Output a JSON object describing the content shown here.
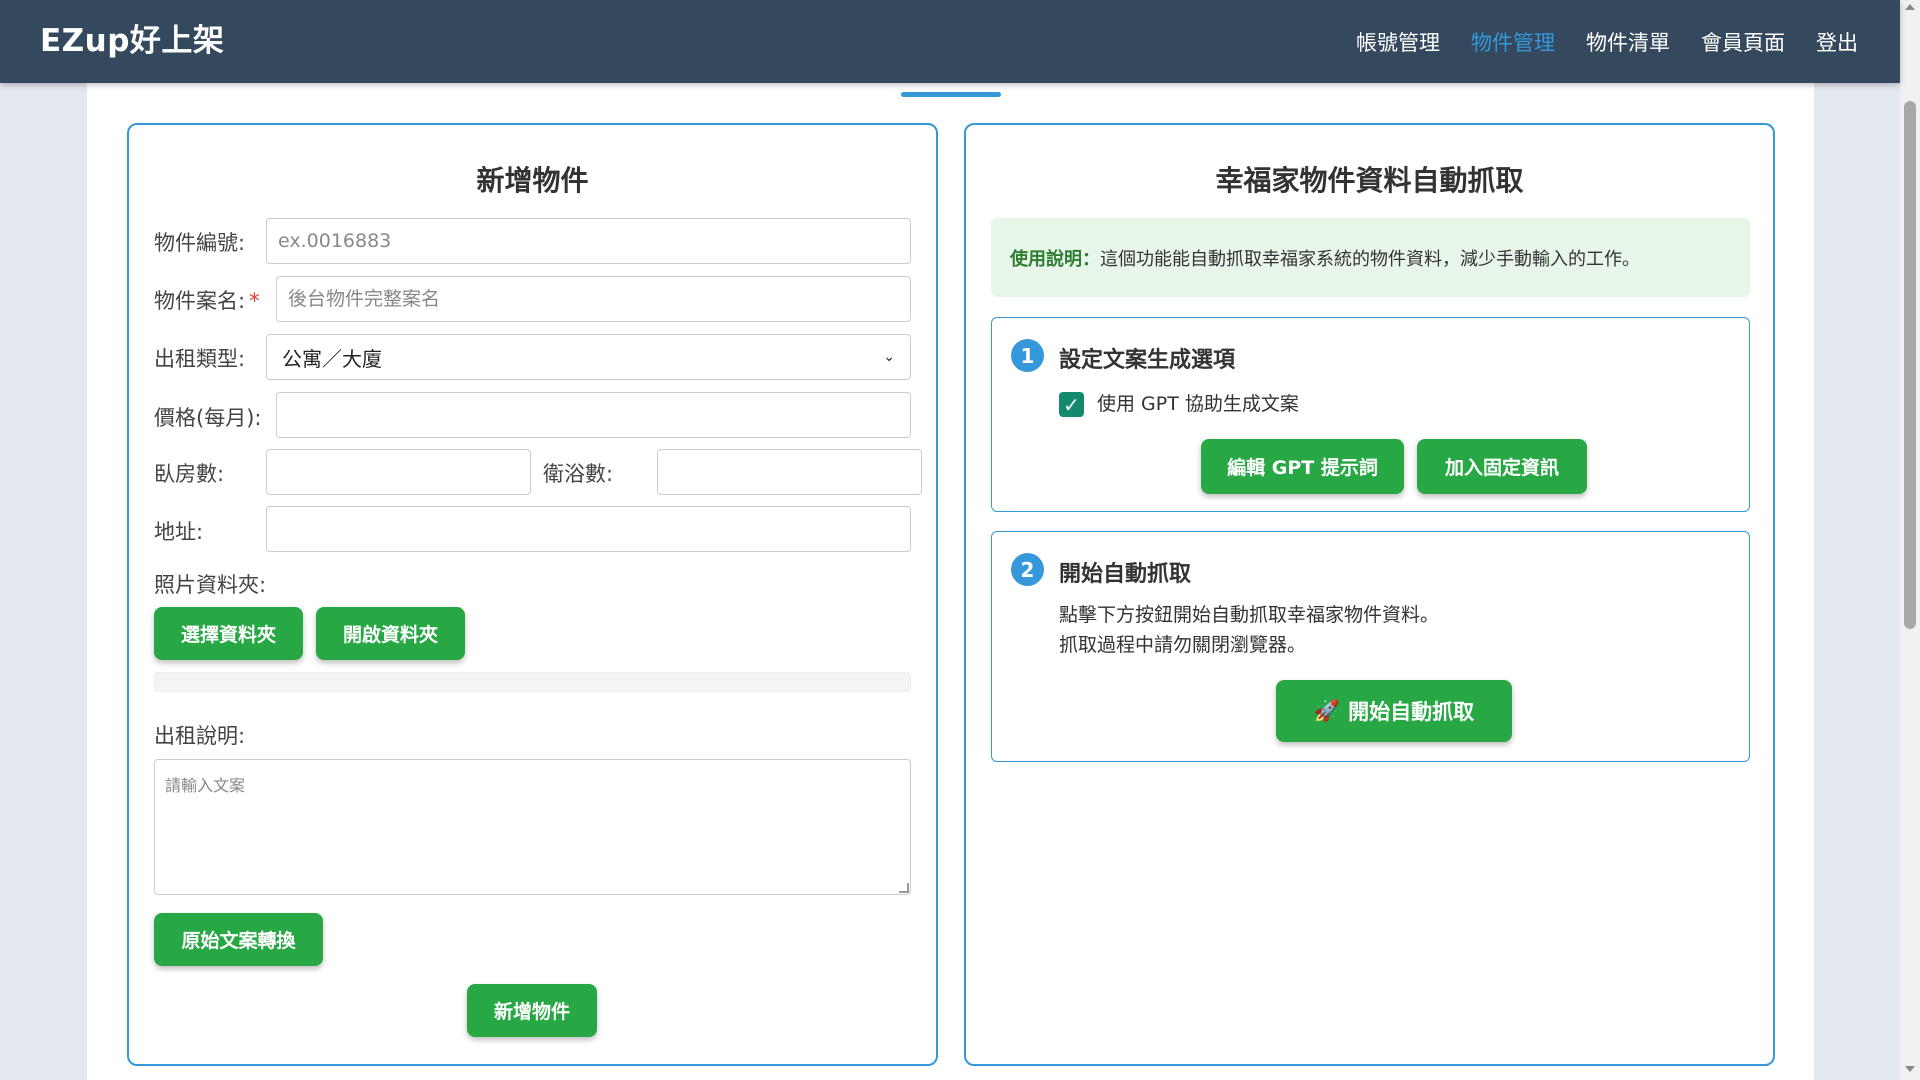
{
  "nav": {
    "brand": "EZup好上架",
    "links": [
      "帳號管理",
      "物件管理",
      "物件清單",
      "會員頁面",
      "登出"
    ],
    "active_index": 1
  },
  "left": {
    "title": "新增物件",
    "labels": {
      "id": "物件編號:",
      "name": "物件案名:",
      "required_mark": "*",
      "type": "出租類型:",
      "price": "價格(每月):",
      "bedrooms": "臥房數:",
      "bathrooms": "衛浴數:",
      "address": "地址:",
      "photos": "照片資料夾:",
      "description": "出租說明:"
    },
    "placeholders": {
      "id": "ex.0016883",
      "name": "後台物件完整案名",
      "description": "請輸入文案"
    },
    "type_value": "公寓／大廈",
    "buttons": {
      "select_folder": "選擇資料夾",
      "open_folder": "開啟資料夾",
      "convert": "原始文案轉換",
      "add": "新增物件"
    }
  },
  "right": {
    "title": "幸福家物件資料自動抓取",
    "info_label": "使用說明：",
    "info_text": "這個功能能自動抓取幸福家系統的物件資料，減少手動輸入的工作。",
    "step1": {
      "number": "1",
      "title": "設定文案生成選項",
      "checkbox_label": "使用 GPT 協助生成文案",
      "checkbox_checked": true,
      "buttons": [
        "編輯 GPT 提示詞",
        "加入固定資訊"
      ]
    },
    "step2": {
      "number": "2",
      "title": "開始自動抓取",
      "desc_line1": "點擊下方按鈕開始自動抓取幸福家物件資料。",
      "desc_line2": "抓取過程中請勿關閉瀏覽器。",
      "button_icon": "🚀",
      "button_label": "開始自動抓取"
    }
  },
  "colors": {
    "navbar": "#34495e",
    "accent": "#3498db",
    "button": "#28a745"
  }
}
